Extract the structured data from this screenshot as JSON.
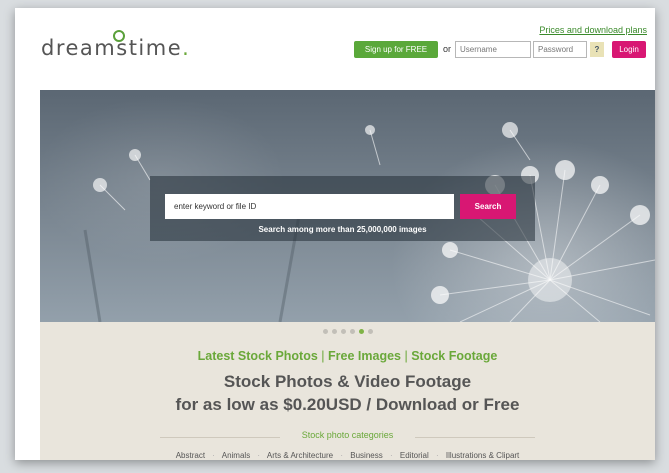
{
  "header": {
    "logo_text": "dreamstime",
    "logo_period": ".",
    "prices_link": "Prices and download plans",
    "signup_label": "Sign up for FREE",
    "or_text": "or",
    "username_placeholder": "Username",
    "password_placeholder": "Password",
    "help_label": "?",
    "login_label": "Login"
  },
  "hero": {
    "search_placeholder": "enter keyword or file ID",
    "search_button": "Search",
    "search_caption": "Search among more than 25,000,000 images",
    "slide_count": 6,
    "active_slide": 5
  },
  "links": {
    "latest": "Latest Stock Photos",
    "separator": "|",
    "free": "Free Images",
    "footage": "Stock Footage"
  },
  "headline": {
    "line1": "Stock Photos & Video Footage",
    "line2": "for as low as $0.20USD / Download or Free"
  },
  "categories": {
    "title": "Stock photo categories",
    "separator": "·",
    "items": [
      "Abstract",
      "Animals",
      "Arts & Architecture",
      "Business",
      "Editorial",
      "Illustrations & Clipart"
    ]
  },
  "colors": {
    "accent_green": "#5aa83a",
    "accent_pink": "#d81773",
    "link_green": "#6aa83a"
  }
}
